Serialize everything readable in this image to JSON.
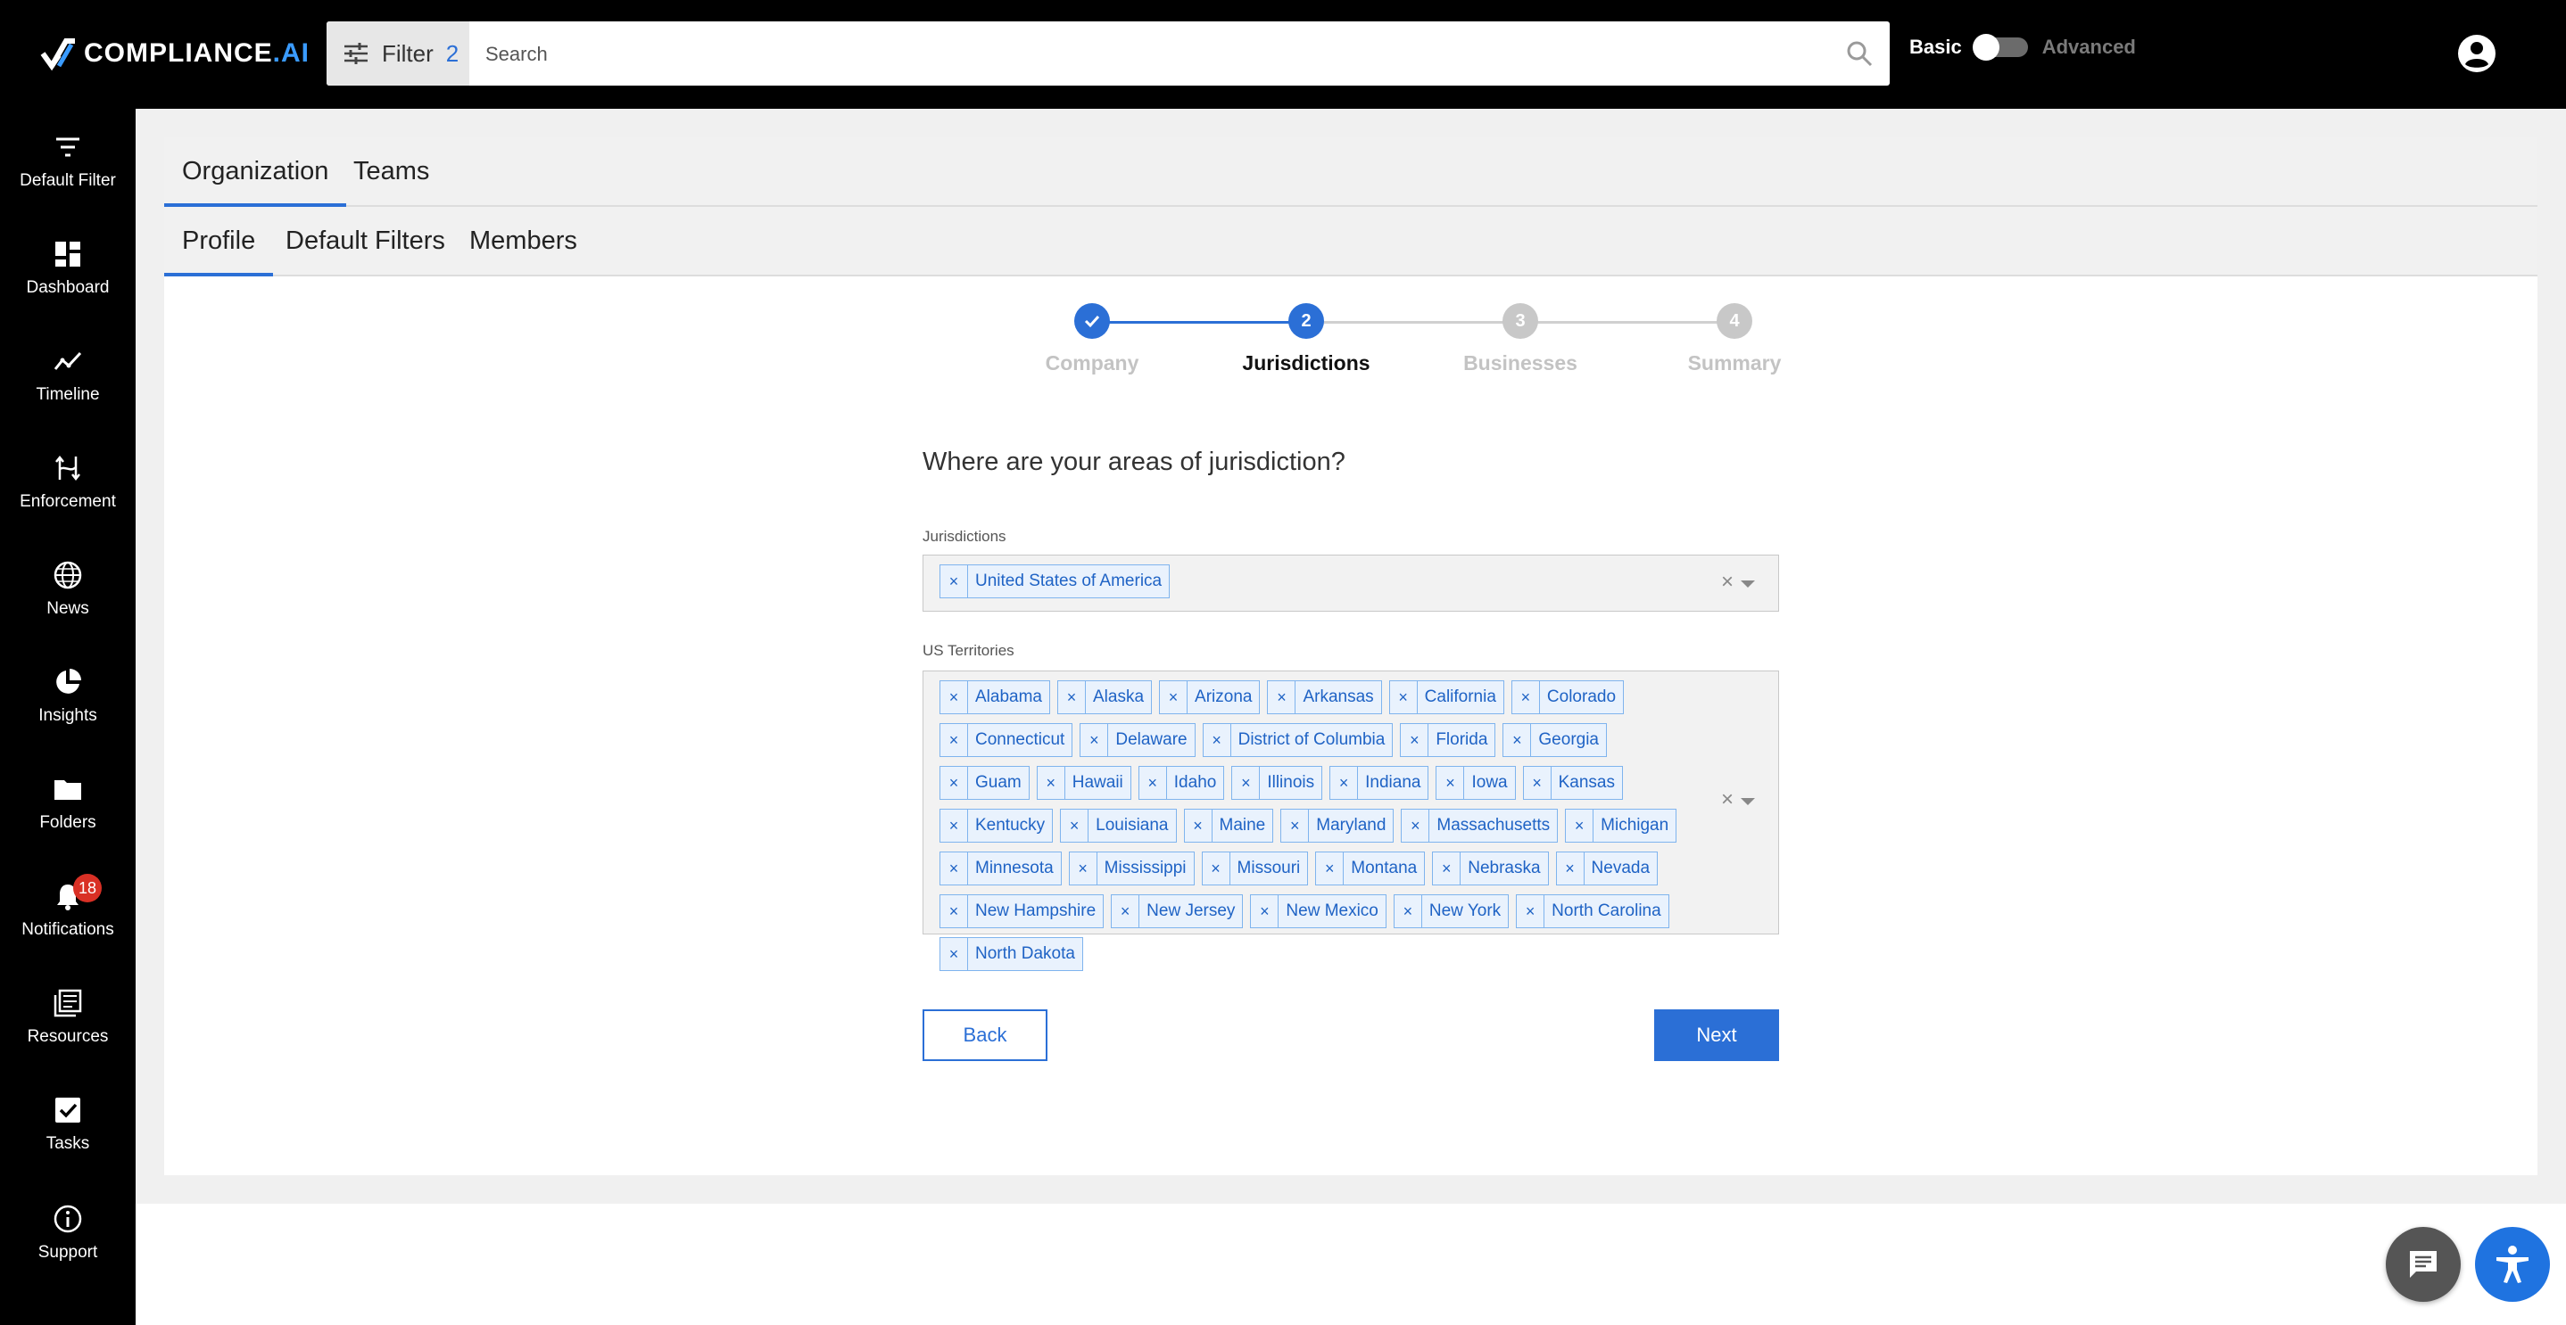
{
  "app": {
    "logo_text": "COMPLIANCE",
    "logo_suffix": ".AI"
  },
  "search": {
    "filter_label": "Filter",
    "filter_count": "2",
    "placeholder": "Search"
  },
  "mode_toggle": {
    "basic": "Basic",
    "advanced": "Advanced",
    "state": "basic"
  },
  "sidebar": {
    "items": [
      {
        "label": "Default Filter",
        "icon": "filter-lines-icon"
      },
      {
        "label": "Dashboard",
        "icon": "dashboard-icon"
      },
      {
        "label": "Timeline",
        "icon": "timeline-icon"
      },
      {
        "label": "Enforcement",
        "icon": "enforcement-icon"
      },
      {
        "label": "News",
        "icon": "globe-icon"
      },
      {
        "label": "Insights",
        "icon": "pie-chart-icon"
      },
      {
        "label": "Folders",
        "icon": "folder-icon"
      },
      {
        "label": "Notifications",
        "icon": "bell-icon",
        "badge": "18"
      },
      {
        "label": "Resources",
        "icon": "resources-icon"
      },
      {
        "label": "Tasks",
        "icon": "checkbox-icon"
      },
      {
        "label": "Support",
        "icon": "info-icon"
      }
    ]
  },
  "tabs_top": [
    "Organization",
    "Teams"
  ],
  "tabs_sub": [
    "Profile",
    "Default Filters",
    "Members"
  ],
  "stepper": {
    "steps": [
      {
        "label": "Company",
        "number": "1",
        "state": "done"
      },
      {
        "label": "Jurisdictions",
        "number": "2",
        "state": "active"
      },
      {
        "label": "Businesses",
        "number": "3",
        "state": "pending"
      },
      {
        "label": "Summary",
        "number": "4",
        "state": "pending"
      }
    ]
  },
  "form": {
    "question": "Where are your areas of jurisdiction?",
    "jurisdictions_label": "Jurisdictions",
    "jurisdictions": [
      "United States of America"
    ],
    "territories_label": "US Territories",
    "territories": [
      "Alabama",
      "Alaska",
      "Arizona",
      "Arkansas",
      "California",
      "Colorado",
      "Connecticut",
      "Delaware",
      "District of Columbia",
      "Florida",
      "Georgia",
      "Guam",
      "Hawaii",
      "Idaho",
      "Illinois",
      "Indiana",
      "Iowa",
      "Kansas",
      "Kentucky",
      "Louisiana",
      "Maine",
      "Maryland",
      "Massachusetts",
      "Michigan",
      "Minnesota",
      "Mississippi",
      "Missouri",
      "Montana",
      "Nebraska",
      "Nevada",
      "New Hampshire",
      "New Jersey",
      "New Mexico",
      "New York",
      "North Carolina",
      "North Dakota"
    ],
    "tag_remove": "×",
    "clear": "×",
    "back": "Back",
    "next": "Next"
  },
  "colors": {
    "accent": "#2b6fd6",
    "pending": "#c8c8c8",
    "badge": "#d93025"
  }
}
